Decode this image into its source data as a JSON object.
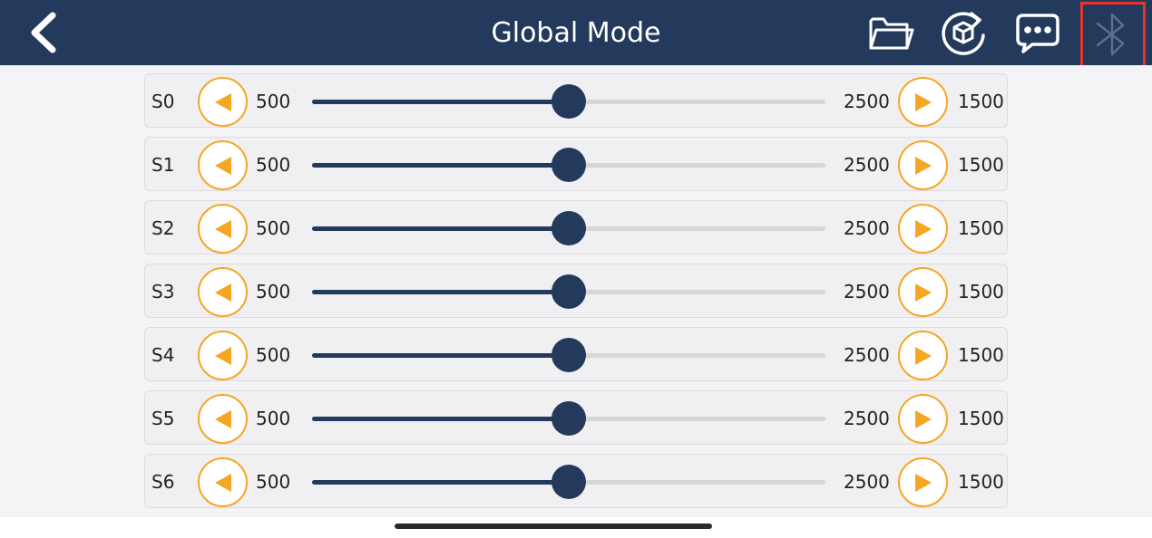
{
  "header": {
    "title": "Global Mode",
    "icons": [
      "back-icon",
      "folder-icon",
      "rotate-cube-icon",
      "chat-bubble-icon",
      "bluetooth-icon"
    ]
  },
  "colors": {
    "header_bg": "#243a5c",
    "accent": "#f5a623",
    "slider_fill": "#243a5c",
    "highlight": "#e5352b"
  },
  "servos": [
    {
      "label": "S0",
      "min": "500",
      "max": "2500",
      "value": "1500",
      "position": 0.5
    },
    {
      "label": "S1",
      "min": "500",
      "max": "2500",
      "value": "1500",
      "position": 0.5
    },
    {
      "label": "S2",
      "min": "500",
      "max": "2500",
      "value": "1500",
      "position": 0.5
    },
    {
      "label": "S3",
      "min": "500",
      "max": "2500",
      "value": "1500",
      "position": 0.5
    },
    {
      "label": "S4",
      "min": "500",
      "max": "2500",
      "value": "1500",
      "position": 0.5
    },
    {
      "label": "S5",
      "min": "500",
      "max": "2500",
      "value": "1500",
      "position": 0.5
    },
    {
      "label": "S6",
      "min": "500",
      "max": "2500",
      "value": "1500",
      "position": 0.5
    }
  ]
}
